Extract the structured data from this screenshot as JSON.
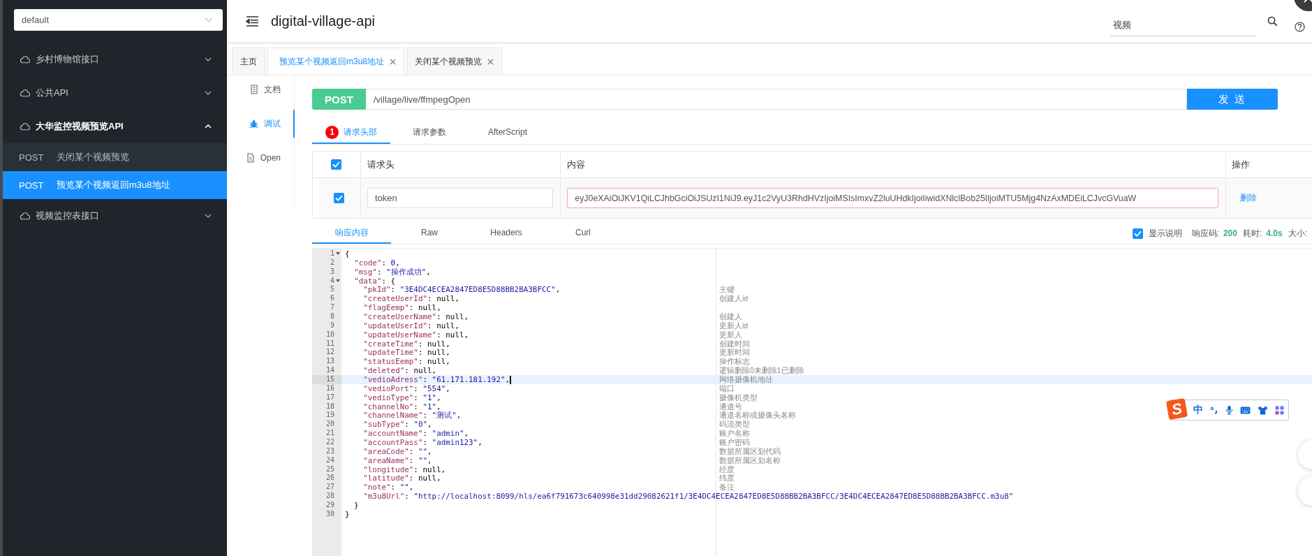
{
  "sidebar": {
    "select": {
      "value": "default"
    },
    "groups": [
      {
        "name": "乡村博物馆接口",
        "expanded": false
      },
      {
        "name": "公共API",
        "expanded": false
      },
      {
        "name": "大华监控视频预览API",
        "expanded": true,
        "children": [
          {
            "method": "POST",
            "name": "关闭某个视频预览",
            "selected": false
          },
          {
            "method": "POST",
            "name": "预览某个视频返回m3u8地址",
            "selected": true
          }
        ]
      },
      {
        "name": "视频监控表接口",
        "expanded": false
      }
    ]
  },
  "header": {
    "title": "digital-village-api",
    "search": {
      "value": "视频"
    }
  },
  "tabs": [
    {
      "label": "主页",
      "selected": false,
      "closable": false
    },
    {
      "label": "预览某个视频返回m3u8地址",
      "selected": true,
      "closable": true
    },
    {
      "label": "关闭某个视频预览",
      "selected": false,
      "closable": true
    }
  ],
  "side_nav": [
    {
      "label": "文档",
      "kind": "doc",
      "selected": false
    },
    {
      "label": "调试",
      "kind": "bug",
      "selected": true
    },
    {
      "label": "Open",
      "kind": "file",
      "selected": false
    }
  ],
  "request": {
    "method": "POST",
    "url": "/village/live/ffmpegOpen",
    "send": "发 送"
  },
  "request_tabs": [
    {
      "label": "请求头部",
      "badge": "1",
      "selected": true
    },
    {
      "label": "请求参数",
      "selected": false
    },
    {
      "label": "AfterScript",
      "selected": false
    }
  ],
  "headers_table": {
    "all_checked": true,
    "columns": [
      "请求头",
      "内容",
      "操作"
    ],
    "rows": [
      {
        "checked": true,
        "name": "token",
        "value": "eyJ0eXAiOiJKV1QiLCJhbGciOiJSUzI1NiJ9.eyJ1c2VyU3RhdHVzIjoiMSIsImxvZ2luUHdkIjoiIiwidXNlclBob25lIjoiMTU5Mjg4NzAxMDEiLCJvcGVuaW",
        "action": "删除"
      }
    ]
  },
  "response_tabs": [
    {
      "label": "响应内容",
      "selected": true
    },
    {
      "label": "Raw",
      "selected": false
    },
    {
      "label": "Headers",
      "selected": false
    },
    {
      "label": "Curl",
      "selected": false
    }
  ],
  "response_meta": {
    "show_desc": {
      "label": "显示说明",
      "checked": true
    },
    "items": [
      {
        "label": "响应码:",
        "value": "200"
      },
      {
        "label": "耗时:",
        "value": "4.0s"
      },
      {
        "label": "大小:"
      }
    ]
  },
  "code": [
    {
      "n": "1",
      "code": "{",
      "fold": true,
      "current": false
    },
    {
      "n": "2",
      "code": "  \"code\": 0,",
      "fold": false,
      "current": false
    },
    {
      "n": "3",
      "code": "  \"msg\": \"操作成功\",",
      "fold": false,
      "current": false
    },
    {
      "n": "4",
      "code": "  \"data\": {",
      "fold": true,
      "current": false
    },
    {
      "n": "5",
      "code": "    \"pkId\": \"3E4DC4ECEA2847ED8E5D88BB2BA3BFCC\",",
      "comment": "主键",
      "fold": false,
      "current": false
    },
    {
      "n": "6",
      "code": "    \"createUserId\": null,",
      "comment": "创建人id",
      "fold": false,
      "current": false
    },
    {
      "n": "7",
      "code": "    \"flagEemp\": null,",
      "fold": false,
      "current": false
    },
    {
      "n": "8",
      "code": "    \"createUserName\": null,",
      "comment": "创建人",
      "fold": false,
      "current": false
    },
    {
      "n": "9",
      "code": "    \"updateUserId\": null,",
      "comment": "更新人id",
      "fold": false,
      "current": false
    },
    {
      "n": "10",
      "code": "    \"updateUserName\": null,",
      "comment": "更新人",
      "fold": false,
      "current": false
    },
    {
      "n": "11",
      "code": "    \"createTime\": null,",
      "comment": "创建时间",
      "fold": false,
      "current": false
    },
    {
      "n": "12",
      "code": "    \"updateTime\": null,",
      "comment": "更新时间",
      "fold": false,
      "current": false
    },
    {
      "n": "13",
      "code": "    \"statusEemp\": null,",
      "comment": "操作标志",
      "fold": false,
      "current": false
    },
    {
      "n": "14",
      "code": "    \"deleted\": null,",
      "comment": "逻辑删除0未删除1已删除",
      "fold": false,
      "current": false
    },
    {
      "n": "15",
      "code": "    \"vedioAdress\": \"61.171.181.192\",",
      "comment": "网络摄像机地址",
      "fold": false,
      "current": true
    },
    {
      "n": "16",
      "code": "    \"vedioPort\": \"554\",",
      "comment": "端口",
      "fold": false,
      "current": false
    },
    {
      "n": "17",
      "code": "    \"vedioType\": \"1\",",
      "comment": "摄像机类型",
      "fold": false,
      "current": false
    },
    {
      "n": "18",
      "code": "    \"channelNo\": \"1\",",
      "comment": "通道号",
      "fold": false,
      "current": false
    },
    {
      "n": "19",
      "code": "    \"channelName\": \"测试\",",
      "comment": "通道名称或摄像头名称",
      "fold": false,
      "current": false
    },
    {
      "n": "20",
      "code": "    \"subType\": \"0\",",
      "comment": "码流类型",
      "fold": false,
      "current": false
    },
    {
      "n": "21",
      "code": "    \"accountName\": \"admin\",",
      "comment": "账户名称",
      "fold": false,
      "current": false
    },
    {
      "n": "22",
      "code": "    \"accountPass\": \"admin123\",",
      "comment": "账户密码",
      "fold": false,
      "current": false
    },
    {
      "n": "23",
      "code": "    \"areaCode\": \"\",",
      "comment": "数据所属区划代码",
      "fold": false,
      "current": false
    },
    {
      "n": "24",
      "code": "    \"areaName\": \"\",",
      "comment": "数据所属区划名称",
      "fold": false,
      "current": false
    },
    {
      "n": "25",
      "code": "    \"longitude\": null,",
      "comment": "经度",
      "fold": false,
      "current": false
    },
    {
      "n": "26",
      "code": "    \"latitude\": null,",
      "comment": "纬度",
      "fold": false,
      "current": false
    },
    {
      "n": "27",
      "code": "    \"note\": \"\",",
      "comment": "备注",
      "fold": false,
      "current": false
    },
    {
      "n": "28",
      "code": "    \"m3u8Url\": \"http://localhost:8099/hls/ea6f791673c640998e31dd29082621f1/3E4DC4ECEA2847ED8E5D88BB2BA3BFCC/3E4DC4ECEA2847ED8E5D88BB2BA3BFCC.m3u8\"",
      "fold": false,
      "current": false
    },
    {
      "n": "29",
      "code": "  }",
      "fold": false,
      "current": false
    },
    {
      "n": "30",
      "code": "}",
      "fold": false,
      "current": false
    }
  ],
  "ime_toolbar": {
    "logo": "S",
    "mode": "中"
  }
}
